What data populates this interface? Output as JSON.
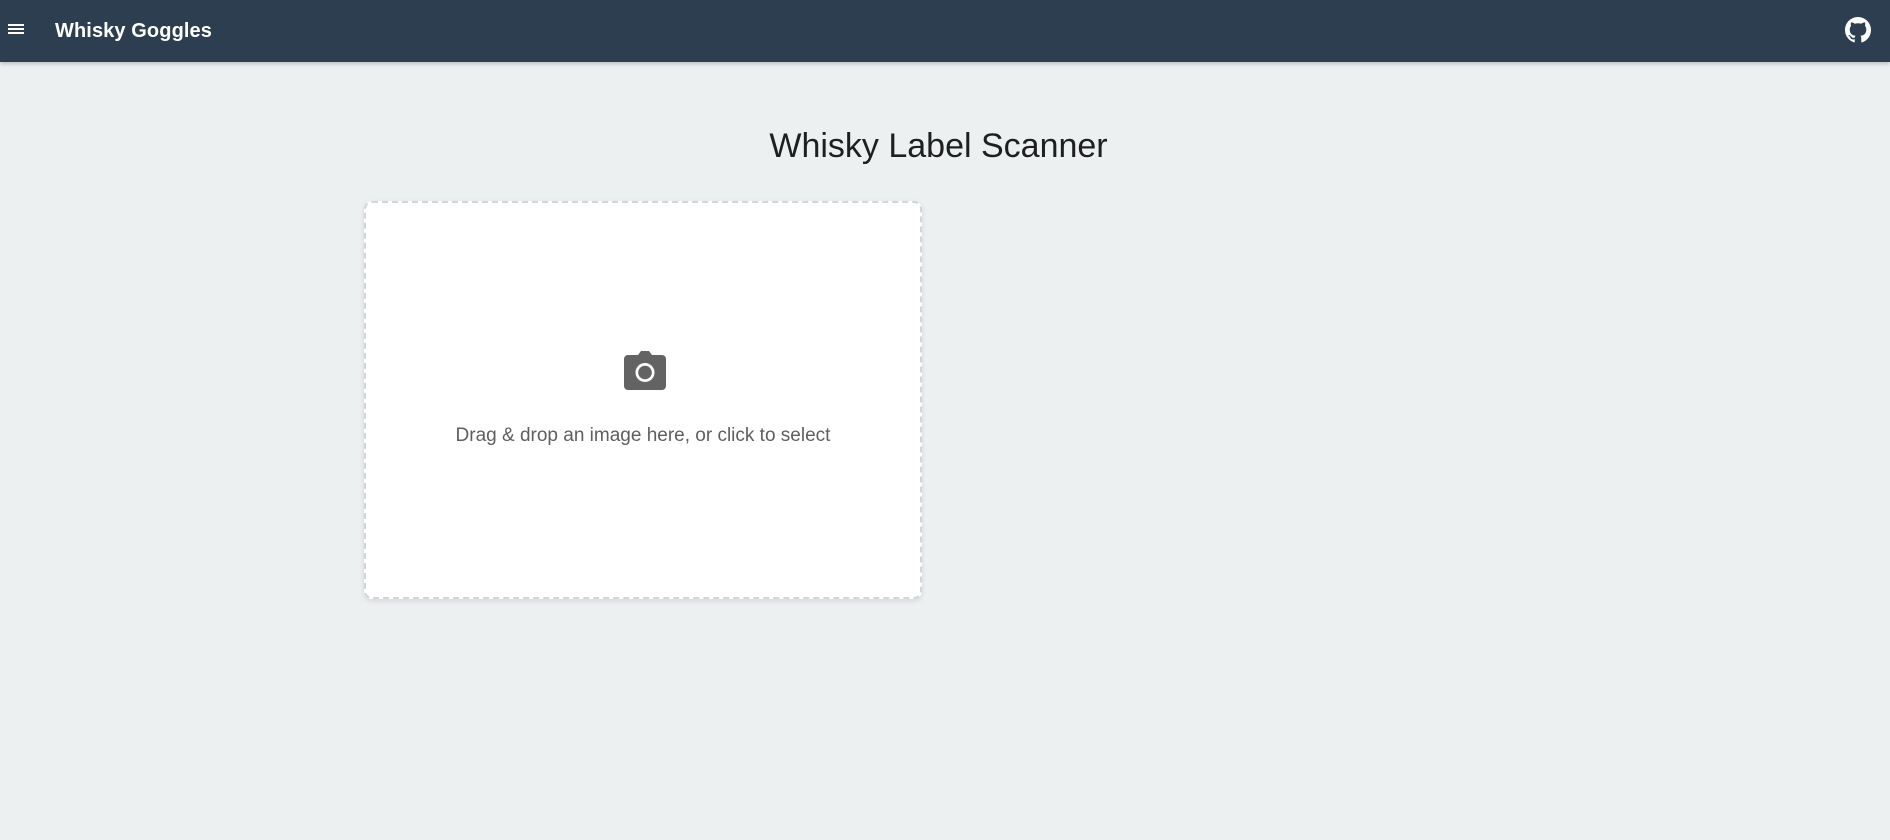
{
  "appbar": {
    "title": "Whisky Goggles",
    "background_color": "#2c3e50",
    "menu_icon": "menu-icon",
    "github_icon": "github-icon"
  },
  "main": {
    "heading": "Whisky Label Scanner",
    "background_color": "#ecf0f1",
    "dropzone": {
      "icon": "camera-icon",
      "hint": "Drag & drop an image here, or click to select"
    }
  }
}
